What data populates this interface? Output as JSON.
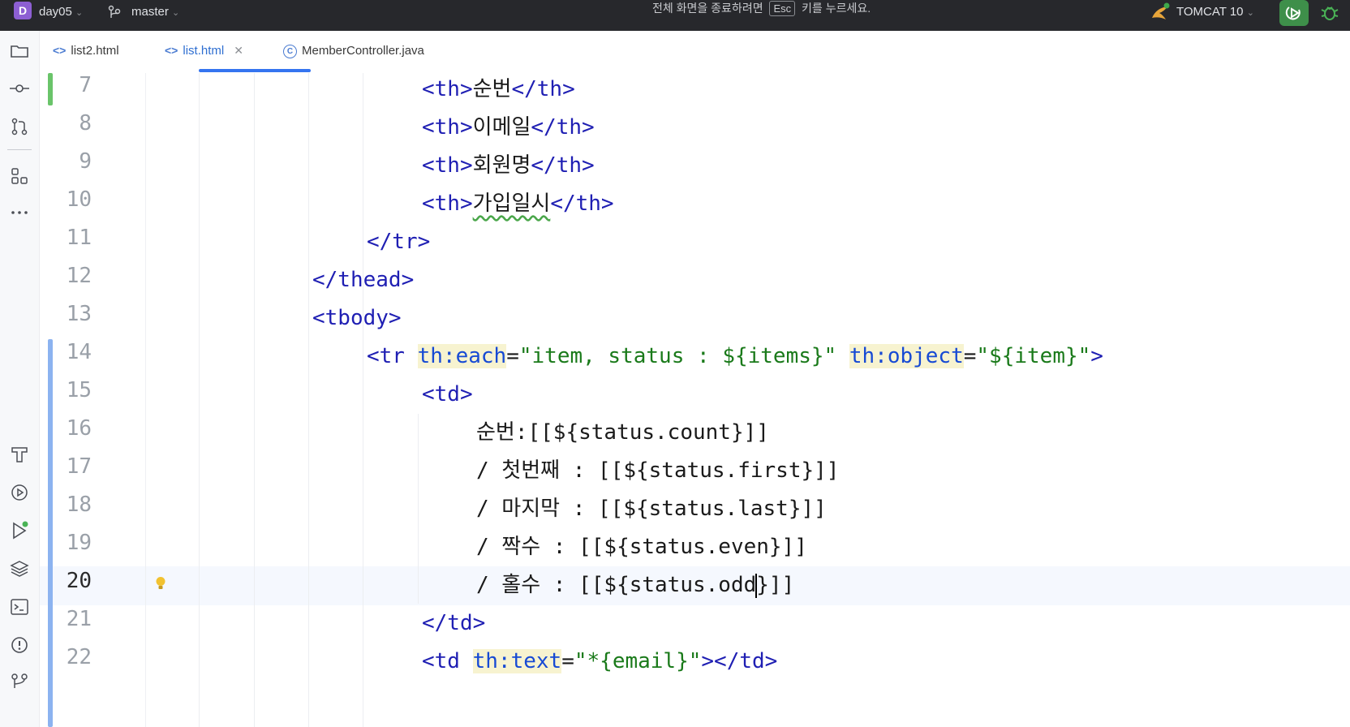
{
  "titlebar": {
    "project_badge": "D",
    "project_name": "day05",
    "branch": "master",
    "notice_before": "전체 화면을 종료하려면",
    "notice_key": "Esc",
    "notice_after": "키를 누르세요.",
    "run_config": "TOMCAT 10"
  },
  "tabs": [
    {
      "label": "list2.html",
      "icon": "html-icon",
      "active": false
    },
    {
      "label": "list.html",
      "icon": "html-icon",
      "active": true,
      "closable": true
    },
    {
      "label": "MemberController.java",
      "icon": "class-icon",
      "active": false
    }
  ],
  "tool_strip": [
    "folder-icon",
    "commit-icon",
    "pull-request-icon",
    "structure-icon",
    "more-icon",
    "build-icon",
    "services-icon",
    "run-icon",
    "layers-icon",
    "terminal-icon",
    "problems-icon",
    "git-icon"
  ],
  "editor": {
    "current_line": "20",
    "lines": [
      {
        "num": "7",
        "t1": "<th>",
        "text": "순번",
        "t2": "</th>"
      },
      {
        "num": "8",
        "t1": "<th>",
        "text": "이메일",
        "t2": "</th>"
      },
      {
        "num": "9",
        "t1": "<th>",
        "text": "회원명",
        "t2": "</th>"
      },
      {
        "num": "10",
        "t1": "<th>",
        "text": "가입일시",
        "t2": "</th>"
      },
      {
        "num": "11",
        "code": "</tr>"
      },
      {
        "num": "12",
        "code": "</thead>"
      },
      {
        "num": "13",
        "code": "<tbody>"
      },
      {
        "num": "14",
        "tag": "<tr",
        "attr1": "th:each",
        "eq1": "=",
        "val1": "\"item, status : ${items}\"",
        "attr2": "th:object",
        "eq2": "=",
        "val2": "\"${item}\"",
        "end": ">"
      },
      {
        "num": "15",
        "code": "<td>"
      },
      {
        "num": "16",
        "code": "순번:[[${status.count}]]"
      },
      {
        "num": "17",
        "code": "/ 첫번째 : [[${status.first}]]"
      },
      {
        "num": "18",
        "code": "/ 마지막 : [[${status.last}]]"
      },
      {
        "num": "19",
        "code": "/ 짝수 : [[${status.even}]]"
      },
      {
        "num": "20",
        "before": "/ 홀수 : [[${status.odd",
        "after": "}]]"
      },
      {
        "num": "21",
        "code": "</td>"
      },
      {
        "num": "22",
        "tag": "<td",
        "attr1": "th:text",
        "eq1": "=",
        "val1": "\"*{email}\"",
        "end": "></td>"
      }
    ]
  },
  "colors": {
    "tag": "#1f1fb3",
    "attribute": "#174ad4",
    "string": "#1a7a1a",
    "attr_highlight": "#f7f3d0",
    "change_added": "#6ac46a",
    "change_modified": "#8cb3f0",
    "tab_active": "#3574f0",
    "run_button": "#3e8f4a"
  }
}
